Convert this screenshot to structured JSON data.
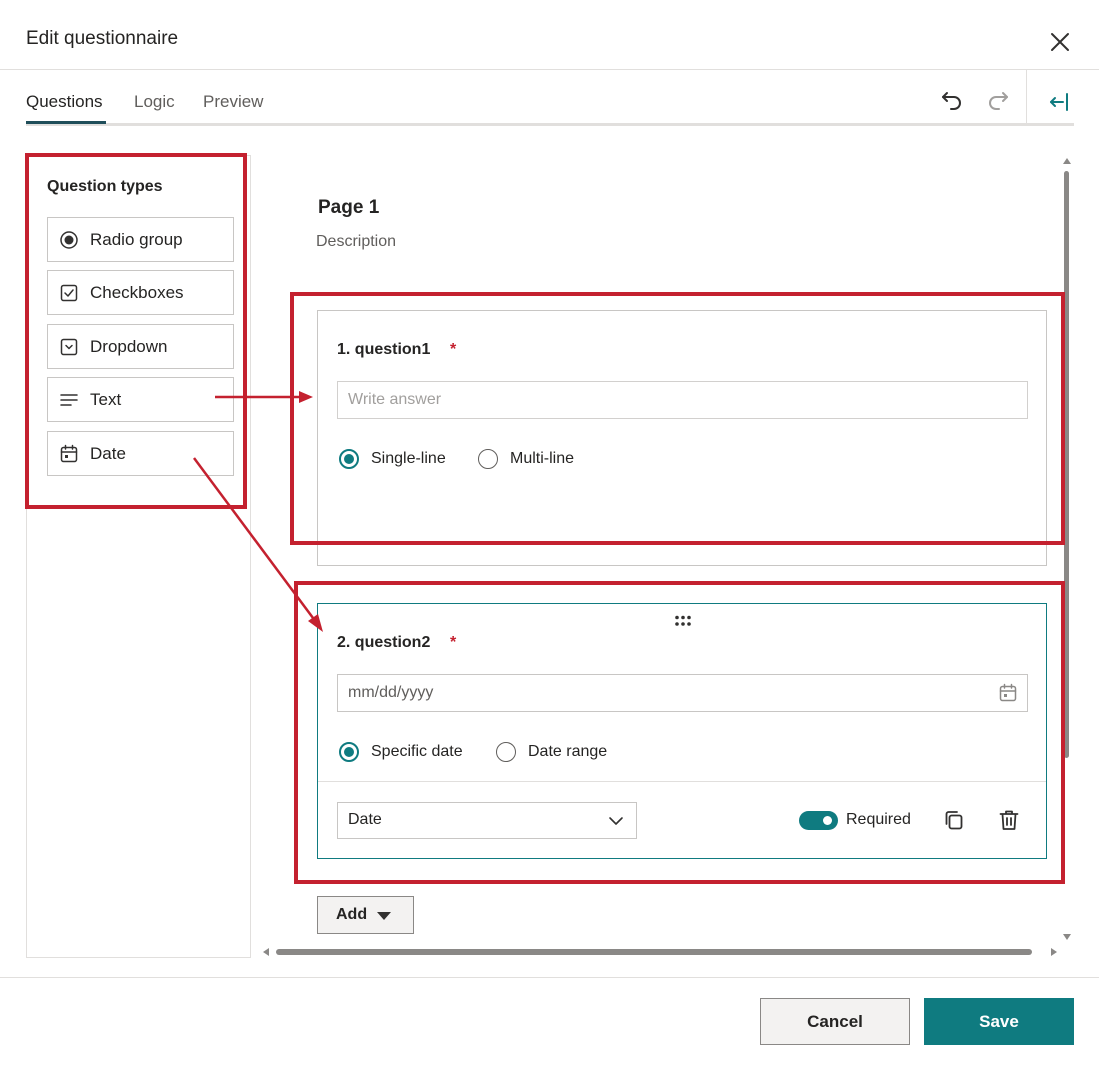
{
  "dialog": {
    "title": "Edit questionnaire"
  },
  "tabs": [
    {
      "label": "Questions",
      "active": true
    },
    {
      "label": "Logic",
      "active": false
    },
    {
      "label": "Preview",
      "active": false
    }
  ],
  "toolbar": {
    "undo_icon": "undo-icon",
    "redo_icon": "redo-icon",
    "collapse_icon": "collapse-panel-icon"
  },
  "palette": {
    "title": "Question types",
    "items": [
      {
        "label": "Radio group",
        "icon": "radio-group-icon"
      },
      {
        "label": "Checkboxes",
        "icon": "checkbox-icon"
      },
      {
        "label": "Dropdown",
        "icon": "dropdown-icon"
      },
      {
        "label": "Text",
        "icon": "text-lines-icon"
      },
      {
        "label": "Date",
        "icon": "calendar-icon"
      }
    ]
  },
  "page": {
    "title": "Page 1",
    "description": "Description"
  },
  "questions": [
    {
      "title": "1. question1",
      "required_mark": "*",
      "placeholder": "Write answer",
      "options": [
        {
          "label": "Single-line",
          "checked": true
        },
        {
          "label": "Multi-line",
          "checked": false
        }
      ]
    },
    {
      "title": "2. question2",
      "required_mark": "*",
      "date_placeholder": "mm/dd/yyyy",
      "options": [
        {
          "label": "Specific date",
          "checked": true
        },
        {
          "label": "Date range",
          "checked": false
        }
      ],
      "type_select": "Date",
      "required_label": "Required",
      "required_on": true
    }
  ],
  "add_button": {
    "label": "Add"
  },
  "footer": {
    "cancel_label": "Cancel",
    "save_label": "Save"
  },
  "colors": {
    "accent": "#0f7b80",
    "highlight": "#c4212f",
    "required": "#c4212f",
    "tab_underline": "#1f4e5a"
  }
}
